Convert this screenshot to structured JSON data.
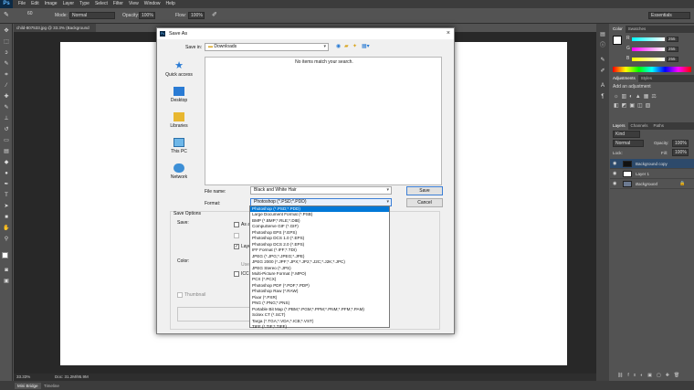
{
  "app": {
    "logo": "Ps"
  },
  "menu": [
    "File",
    "Edit",
    "Image",
    "Layer",
    "Type",
    "Select",
    "Filter",
    "View",
    "Window",
    "Help"
  ],
  "options_bar": {
    "brush_size": "60",
    "mode_label": "Mode:",
    "mode_value": "Normal",
    "opacity_label": "Opacity:",
    "opacity_value": "100%",
    "flow_label": "Flow:",
    "flow_value": "100%",
    "workspace": "Essentials"
  },
  "document": {
    "tab_label": "child-807533.jpg @ 33.3% (Background copy, RGB/8#) *",
    "zoom": "33.33%",
    "doc_info": "Doc: 31.2M/95.9M"
  },
  "bottom_tabs": {
    "mini_bridge": "Mini Bridge",
    "timeline": "Timeline"
  },
  "color_panel": {
    "tabs": [
      "Color",
      "Swatches"
    ],
    "r_label": "R",
    "r_value": "255",
    "g_label": "G",
    "g_value": "255",
    "b_label": "B",
    "b_value": "255"
  },
  "adjustments_panel": {
    "tabs": [
      "Adjustments",
      "Styles"
    ],
    "heading": "Add an adjustment"
  },
  "layers_panel": {
    "tabs": [
      "Layers",
      "Channels",
      "Paths"
    ],
    "kind": "Kind",
    "blend": "Normal",
    "opacity_label": "Opacity:",
    "opacity_value": "100%",
    "lock_label": "Lock:",
    "fill_label": "Fill:",
    "fill_value": "100%",
    "layers": [
      {
        "name": "Background copy",
        "selected": true
      },
      {
        "name": "Layer 1",
        "selected": false
      },
      {
        "name": "Background",
        "selected": false
      }
    ]
  },
  "dialog": {
    "title": "Save As",
    "save_in_label": "Save in:",
    "save_in_value": "Downloads",
    "empty_message": "No items match your search.",
    "places": [
      "Quick access",
      "Desktop",
      "Libraries",
      "This PC",
      "Network"
    ],
    "file_name_label": "File name:",
    "file_name_value": "Black and White Hair",
    "format_label": "Format:",
    "format_value": "Photoshop (*.PSD;*.PDD)",
    "save_button": "Save",
    "cancel_button": "Cancel",
    "save_options_label": "Save Options",
    "save_label": "Save:",
    "as_copy_label": "As a",
    "layers_label": "Laye",
    "color_label": "Color:",
    "use_label": "Use",
    "icc_label": "ICC",
    "thumbnail_label": "Thumbnail"
  },
  "format_options": [
    "Photoshop (*.PSD;*.PDD)",
    "Large Document Format (*.PSB)",
    "BMP (*.BMP;*.RLE;*.DIB)",
    "CompuServe GIF (*.GIF)",
    "Photoshop EPS (*.EPS)",
    "Photoshop DCS 1.0 (*.EPS)",
    "Photoshop DCS 2.0 (*.EPS)",
    "IFF Format (*.IFF;*.TDI)",
    "JPEG (*.JPG;*.JPEG;*.JPE)",
    "JPEG 2000 (*.JPF;*.JPX;*.JP2;*.J2C;*.J2K;*.JPC)",
    "JPEG Stereo (*.JPS)",
    "Multi-Picture Format (*.MPO)",
    "PCX (*.PCX)",
    "Photoshop PDF (*.PDF;*.PDP)",
    "Photoshop Raw (*.RAW)",
    "Pixar (*.PXR)",
    "PNG (*.PNG;*.PNS)",
    "Portable Bit Map (*.PBM;*.PGM;*.PPM;*.PNM;*.PFM;*.PAM)",
    "Scitex CT (*.SCT)",
    "Targa (*.TGA;*.VDA;*.ICB;*.VST)",
    "TIFF (*.TIF;*.TIFF)"
  ],
  "colors": {
    "selection": "#0078d7",
    "ps_blue": "#5fb7ff"
  }
}
